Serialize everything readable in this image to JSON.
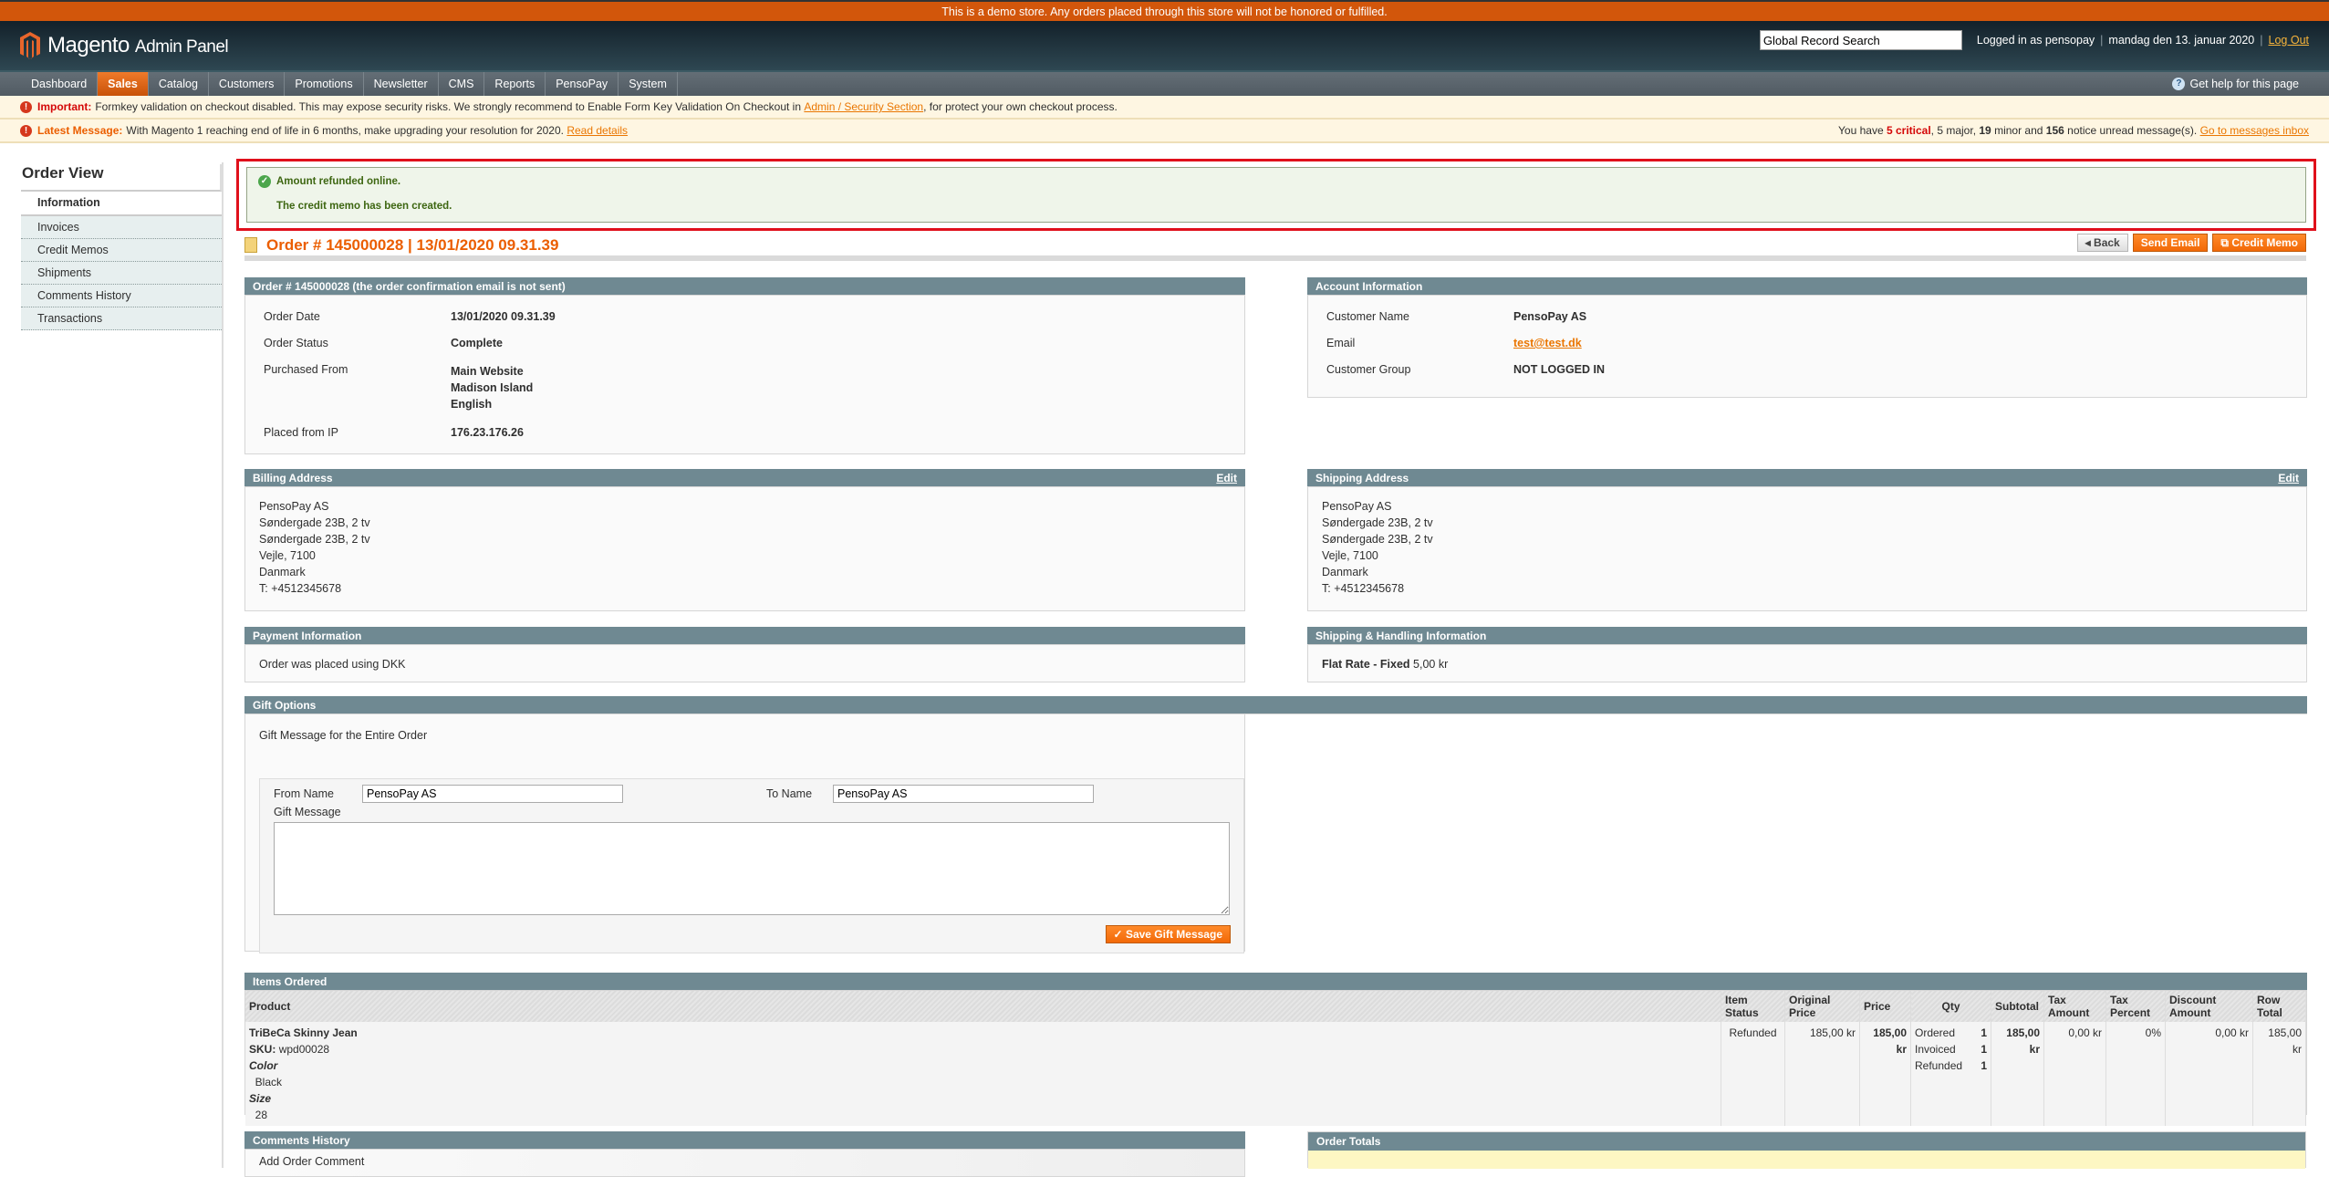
{
  "demo_notice": "This is a demo store. Any orders placed through this store will not be honored or fulfilled.",
  "header": {
    "logo_brand": "Magento",
    "logo_sub": "Admin Panel",
    "search_value": "Global Record Search",
    "logged_in": "Logged in as pensopay",
    "date": "mandag den 13. januar 2020",
    "logout": "Log Out"
  },
  "nav": {
    "items": [
      "Dashboard",
      "Sales",
      "Catalog",
      "Customers",
      "Promotions",
      "Newsletter",
      "CMS",
      "Reports",
      "PensoPay",
      "System"
    ],
    "active": "Sales",
    "help": "Get help for this page"
  },
  "notices": {
    "important_label": "Important:",
    "important_text": "Formkey validation on checkout disabled. This may expose security risks. We strongly recommend to Enable Form Key Validation On Checkout in",
    "important_link": "Admin / Security Section",
    "important_tail": ", for protect your own checkout process.",
    "latest_label": "Latest Message:",
    "latest_text": "With Magento 1 reaching end of life in 6 months, make upgrading your resolution for 2020.",
    "latest_link": "Read details",
    "summary_prefix": "You have",
    "critical": "5 critical",
    "major": ", 5 major,",
    "minor": "19",
    "minor_text": "minor and",
    "notice": "156",
    "notice_text": "notice unread message(s).",
    "inbox_link": "Go to messages inbox"
  },
  "sidebar": {
    "title": "Order View",
    "tabs": [
      "Information",
      "Invoices",
      "Credit Memos",
      "Shipments",
      "Comments History",
      "Transactions"
    ]
  },
  "messages": [
    "Amount refunded online.",
    "The credit memo has been created."
  ],
  "order": {
    "title": "Order # 145000028 | 13/01/2020 09.31.39",
    "buttons": {
      "back": "Back",
      "send_email": "Send Email",
      "credit_memo": "Credit Memo"
    }
  },
  "order_info": {
    "header": "Order # 145000028 (the order confirmation email is not sent)",
    "rows": [
      {
        "label": "Order Date",
        "value": "13/01/2020 09.31.39"
      },
      {
        "label": "Order Status",
        "value": "Complete"
      },
      {
        "label": "Purchased From",
        "value": "Main Website\nMadison Island\nEnglish"
      },
      {
        "label": "Placed from IP",
        "value": "176.23.176.26"
      }
    ]
  },
  "account": {
    "header": "Account Information",
    "name_label": "Customer Name",
    "name": "PensoPay AS",
    "email_label": "Email",
    "email": "test@test.dk",
    "group_label": "Customer Group",
    "group": "NOT LOGGED IN"
  },
  "billing": {
    "header": "Billing Address",
    "edit": "Edit",
    "lines": [
      "PensoPay AS",
      "Søndergade 23B, 2 tv",
      "Søndergade 23B, 2 tv",
      "Vejle, 7100",
      "Danmark",
      "T: +4512345678"
    ]
  },
  "shipping": {
    "header": "Shipping Address",
    "edit": "Edit",
    "lines": [
      "PensoPay AS",
      "Søndergade 23B, 2 tv",
      "Søndergade 23B, 2 tv",
      "Vejle, 7100",
      "Danmark",
      "T: +4512345678"
    ]
  },
  "payment": {
    "header": "Payment Information",
    "text": "Order was placed using DKK"
  },
  "shipping_method": {
    "header": "Shipping & Handling Information",
    "method": "Flat Rate - Fixed",
    "price": "5,00 kr"
  },
  "gift": {
    "header": "Gift Options",
    "subtitle": "Gift Message for the Entire Order",
    "from_label": "From Name",
    "from_value": "PensoPay AS",
    "to_label": "To Name",
    "to_value": "PensoPay AS",
    "message_label": "Gift Message",
    "save": "Save Gift Message"
  },
  "items": {
    "header": "Items Ordered",
    "columns": [
      "Product",
      "Item Status",
      "Original Price",
      "Price",
      "Qty",
      "Subtotal",
      "Tax Amount",
      "Tax Percent",
      "Discount Amount",
      "Row Total"
    ],
    "rows": [
      {
        "name": "TriBeCa Skinny Jean",
        "sku_label": "SKU:",
        "sku": "wpd00028",
        "opt1_label": "Color",
        "opt1": "Black",
        "opt2_label": "Size",
        "opt2": "28",
        "status": "Refunded",
        "original_price": "185,00 kr",
        "price": "185,00 kr",
        "qty": [
          {
            "label": "Ordered",
            "value": "1"
          },
          {
            "label": "Invoiced",
            "value": "1"
          },
          {
            "label": "Refunded",
            "value": "1"
          }
        ],
        "subtotal": "185,00 kr",
        "tax_amount": "0,00 kr",
        "tax_percent": "0%",
        "discount": "0,00 kr",
        "row_total": "185,00 kr"
      }
    ]
  },
  "comments": {
    "header": "Comments History",
    "add_label": "Add Order Comment"
  },
  "totals": {
    "header": "Order Totals"
  }
}
